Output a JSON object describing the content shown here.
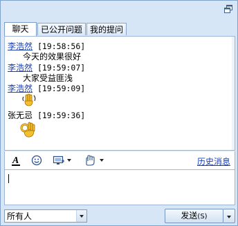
{
  "window": {
    "restore_icon": "restore-window-icon"
  },
  "tabs": [
    {
      "label": "聊天",
      "active": true
    },
    {
      "label": "已公开问题",
      "active": false
    },
    {
      "label": "我的提问",
      "active": false
    }
  ],
  "messages": [
    {
      "sender": "李浩然",
      "sender_link": true,
      "time": "[19:58:56]",
      "text": "今天的效果很好"
    },
    {
      "sender": "李浩然",
      "sender_link": true,
      "time": "[19:59:07]",
      "text": "大家受益匪浅"
    },
    {
      "sender": "李浩然",
      "sender_link": true,
      "time": "[19:59:09]",
      "emoji": "waving-hand-emoji"
    },
    {
      "sender": "张无忌",
      "sender_link": false,
      "time": "[19:59:36]",
      "emoji": "ok-hand-emoji"
    }
  ],
  "toolbar": {
    "font_icon": "font-icon",
    "smiley_icon": "smiley-icon",
    "screenshot_icon": "screen-capture-icon",
    "gesture_icon": "hand-gesture-icon",
    "history_label": "历史消息"
  },
  "input": {
    "value": ""
  },
  "recipient": {
    "selected": "所有人"
  },
  "send": {
    "label": "发送",
    "shortcut": "(S)"
  },
  "colors": {
    "link": "#1a3fb1",
    "background": "#d6e6f7",
    "border": "#9db6d6"
  }
}
